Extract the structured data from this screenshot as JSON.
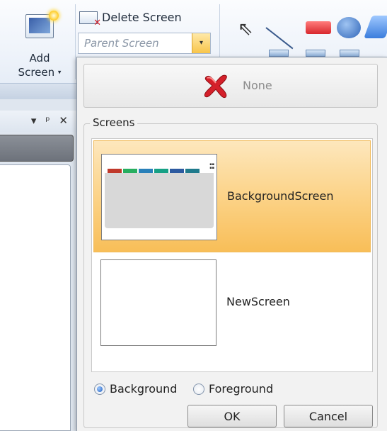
{
  "ribbon": {
    "add_screen": {
      "label_line1": "Add",
      "label_line2": "Screen",
      "caret": "▾",
      "icon": "add-screen-icon"
    },
    "delete_screen": {
      "label": "Delete Screen",
      "icon": "delete-screen-icon"
    },
    "parent_screen": {
      "placeholder": "Parent Screen",
      "caret": "▾"
    },
    "shape_tools": [
      "pointer",
      "line",
      "rectangle",
      "ellipse",
      "more-shapes"
    ]
  },
  "side_panel": {
    "header_icons": "▾ ᵖ ✕"
  },
  "popup": {
    "none_button": {
      "label": "None",
      "icon": "red-x-icon"
    },
    "screens_group": {
      "legend": "Screens",
      "items": [
        {
          "name": "BackgroundScreen",
          "selected": true
        },
        {
          "name": "NewScreen",
          "selected": false
        }
      ]
    },
    "layer": {
      "options": [
        "Background",
        "Foreground"
      ],
      "selected": "Background"
    },
    "buttons": {
      "ok": "OK",
      "cancel": "Cancel"
    }
  },
  "colors": {
    "selection": "#f8be58",
    "accent_blue": "#1f5fbf",
    "x_red": "#d4202a"
  }
}
